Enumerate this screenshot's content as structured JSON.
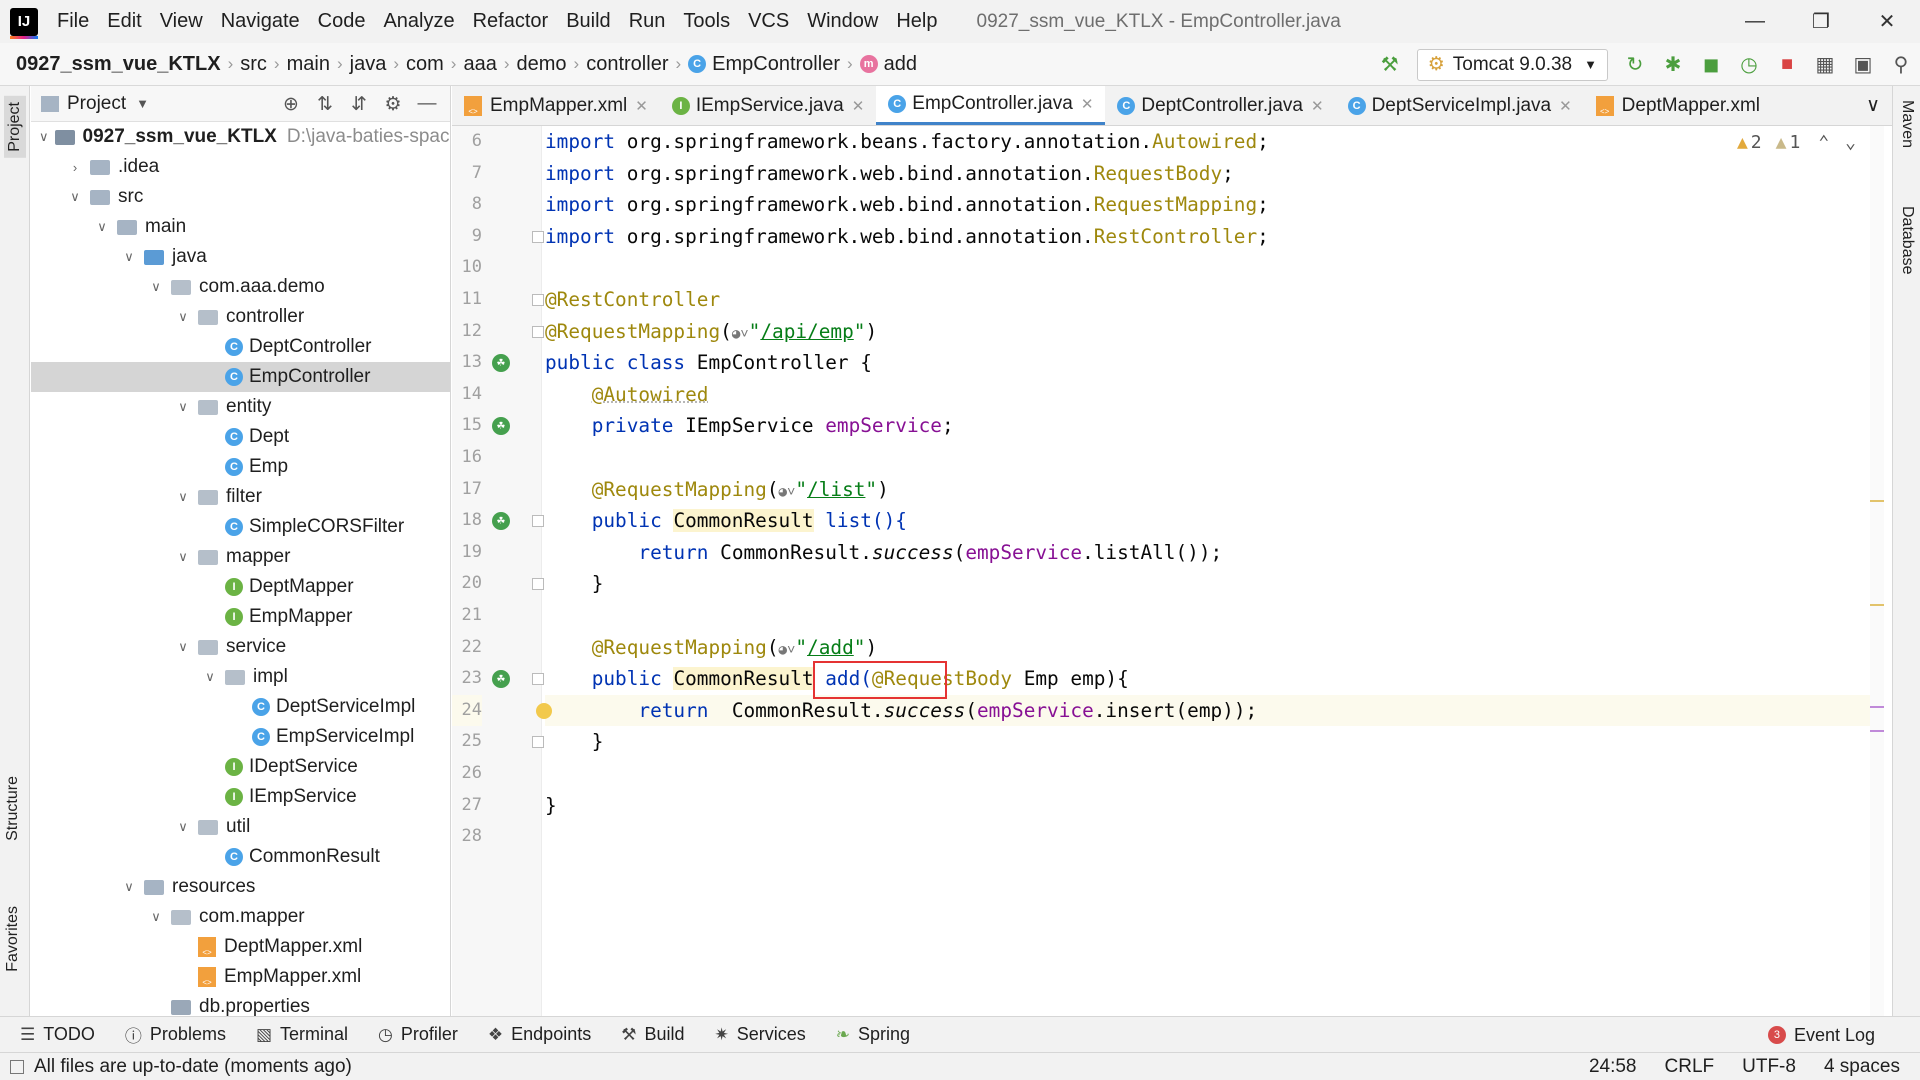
{
  "menubar": {
    "logo": "IJ",
    "items": [
      "File",
      "Edit",
      "View",
      "Navigate",
      "Code",
      "Analyze",
      "Refactor",
      "Build",
      "Run",
      "Tools",
      "VCS",
      "Window",
      "Help"
    ],
    "window_title": "0927_ssm_vue_KTLX - EmpController.java"
  },
  "navbar": {
    "breadcrumbs": [
      "0927_ssm_vue_KTLX",
      "src",
      "main",
      "java",
      "com",
      "aaa",
      "demo",
      "controller",
      "EmpController",
      "add"
    ],
    "run_config": "Tomcat 9.0.38"
  },
  "project_panel": {
    "title": "Project",
    "tree": [
      {
        "label": "0927_ssm_vue_KTLX",
        "path": "D:\\java-baties-space",
        "depth": 0,
        "expanded": true,
        "type": "module"
      },
      {
        "label": ".idea",
        "depth": 1,
        "expanded": false,
        "type": "folder"
      },
      {
        "label": "src",
        "depth": 1,
        "expanded": true,
        "type": "folder"
      },
      {
        "label": "main",
        "depth": 2,
        "expanded": true,
        "type": "folder"
      },
      {
        "label": "java",
        "depth": 3,
        "expanded": true,
        "type": "source"
      },
      {
        "label": "com.aaa.demo",
        "depth": 4,
        "expanded": true,
        "type": "package"
      },
      {
        "label": "controller",
        "depth": 5,
        "expanded": true,
        "type": "package"
      },
      {
        "label": "DeptController",
        "depth": 6,
        "type": "class"
      },
      {
        "label": "EmpController",
        "depth": 6,
        "type": "class",
        "selected": true
      },
      {
        "label": "entity",
        "depth": 5,
        "expanded": true,
        "type": "package"
      },
      {
        "label": "Dept",
        "depth": 6,
        "type": "class"
      },
      {
        "label": "Emp",
        "depth": 6,
        "type": "class"
      },
      {
        "label": "filter",
        "depth": 5,
        "expanded": true,
        "type": "package"
      },
      {
        "label": "SimpleCORSFilter",
        "depth": 6,
        "type": "class"
      },
      {
        "label": "mapper",
        "depth": 5,
        "expanded": true,
        "type": "package"
      },
      {
        "label": "DeptMapper",
        "depth": 6,
        "type": "interface"
      },
      {
        "label": "EmpMapper",
        "depth": 6,
        "type": "interface"
      },
      {
        "label": "service",
        "depth": 5,
        "expanded": true,
        "type": "package"
      },
      {
        "label": "impl",
        "depth": 6,
        "expanded": true,
        "type": "package"
      },
      {
        "label": "DeptServiceImpl",
        "depth": 7,
        "type": "class"
      },
      {
        "label": "EmpServiceImpl",
        "depth": 7,
        "type": "class"
      },
      {
        "label": "IDeptService",
        "depth": 6,
        "type": "interface"
      },
      {
        "label": "IEmpService",
        "depth": 6,
        "type": "interface"
      },
      {
        "label": "util",
        "depth": 5,
        "expanded": true,
        "type": "package"
      },
      {
        "label": "CommonResult",
        "depth": 6,
        "type": "class"
      },
      {
        "label": "resources",
        "depth": 3,
        "expanded": true,
        "type": "folder"
      },
      {
        "label": "com.mapper",
        "depth": 4,
        "expanded": true,
        "type": "package"
      },
      {
        "label": "DeptMapper.xml",
        "depth": 5,
        "type": "xml"
      },
      {
        "label": "EmpMapper.xml",
        "depth": 5,
        "type": "xml"
      },
      {
        "label": "db.properties",
        "depth": 4,
        "type": "file"
      }
    ]
  },
  "editor_tabs": [
    {
      "label": "EmpMapper.xml",
      "icon": "xml-file-icon",
      "closable": true
    },
    {
      "label": "IEmpService.java",
      "icon": "interface-icon",
      "closable": true
    },
    {
      "label": "EmpController.java",
      "icon": "class-icon",
      "closable": true,
      "active": true
    },
    {
      "label": "DeptController.java",
      "icon": "class-icon",
      "closable": true
    },
    {
      "label": "DeptServiceImpl.java",
      "icon": "class-icon",
      "closable": true
    },
    {
      "label": "DeptMapper.xml",
      "icon": "xml-file-icon",
      "closable": false
    }
  ],
  "editor": {
    "warnings": {
      "warn_count": "2",
      "weak_count": "1"
    },
    "first_line": 6,
    "lines": [
      {
        "n": "6"
      },
      {
        "n": "7"
      },
      {
        "n": "8"
      },
      {
        "n": "9"
      },
      {
        "n": "10"
      },
      {
        "n": "11"
      },
      {
        "n": "12"
      },
      {
        "n": "13"
      },
      {
        "n": "14"
      },
      {
        "n": "15"
      },
      {
        "n": "16"
      },
      {
        "n": "17"
      },
      {
        "n": "18"
      },
      {
        "n": "19"
      },
      {
        "n": "20"
      },
      {
        "n": "21"
      },
      {
        "n": "22"
      },
      {
        "n": "23"
      },
      {
        "n": "24"
      },
      {
        "n": "25"
      },
      {
        "n": "26"
      },
      {
        "n": "27"
      },
      {
        "n": "28"
      }
    ],
    "code": {
      "l6_pkg": "org.springframework.beans.factory.annotation.",
      "l6_cls": "Autowired",
      "l7_pkg": "org.springframework.web.bind.annotation.",
      "l7_cls": "RequestBody",
      "l8_pkg": "org.springframework.web.bind.annotation.",
      "l8_cls": "RequestMapping",
      "l9_pkg": "org.springframework.web.bind.annotation.",
      "l9_cls": "RestController",
      "import_kw": "import",
      "l11": "@RestController",
      "l12_ann": "@RequestMapping",
      "l12_path": "/api/emp",
      "l13_kw": "public class",
      "l13_name": "EmpController {",
      "l14": "@Autowired",
      "l15_kw": "private",
      "l15_type": "IEmpService",
      "l15_field": "empService",
      "l17_ann": "@RequestMapping",
      "l17_path": "/list",
      "l18_kw": "public",
      "l18_type": "CommonResult",
      "l18_rest": "list(){",
      "l19_kw": "return",
      "l19_a": "CommonResult.",
      "l19_m": "success",
      "l19_field": "empService",
      "l19_b": ".listAll());",
      "l20": "}",
      "l22_ann": "@RequestMapping",
      "l22_path": "/add",
      "l23_kw": "public",
      "l23_type": "CommonResult",
      "l23_a": "add(",
      "l23_ann": "@RequestBody",
      "l23_b": "Emp emp){",
      "l24_kw": "return",
      "l24_a": "CommonResult.",
      "l24_m": "success",
      "l24_field": "empService",
      "l24_b": ".insert(emp));",
      "l25": "}",
      "l27": "}"
    }
  },
  "right_stripe": [
    "Maven",
    "Database"
  ],
  "left_stripe": [
    "Project",
    "Structure",
    "Favorites"
  ],
  "bottom_toolbar": [
    "TODO",
    "Problems",
    "Terminal",
    "Profiler",
    "Endpoints",
    "Build",
    "Services",
    "Spring"
  ],
  "event_log": {
    "label": "Event Log",
    "count": "3"
  },
  "statusbar": {
    "message": "All files are up-to-date (moments ago)",
    "position": "24:58",
    "line_sep": "CRLF",
    "encoding": "UTF-8",
    "indent": "4 spaces"
  },
  "colors": {
    "accent": "#4083c9",
    "highlight_box": "#e53333",
    "annotation": "#9e880d",
    "keyword": "#0033b3",
    "string": "#067d17",
    "field": "#871094"
  }
}
